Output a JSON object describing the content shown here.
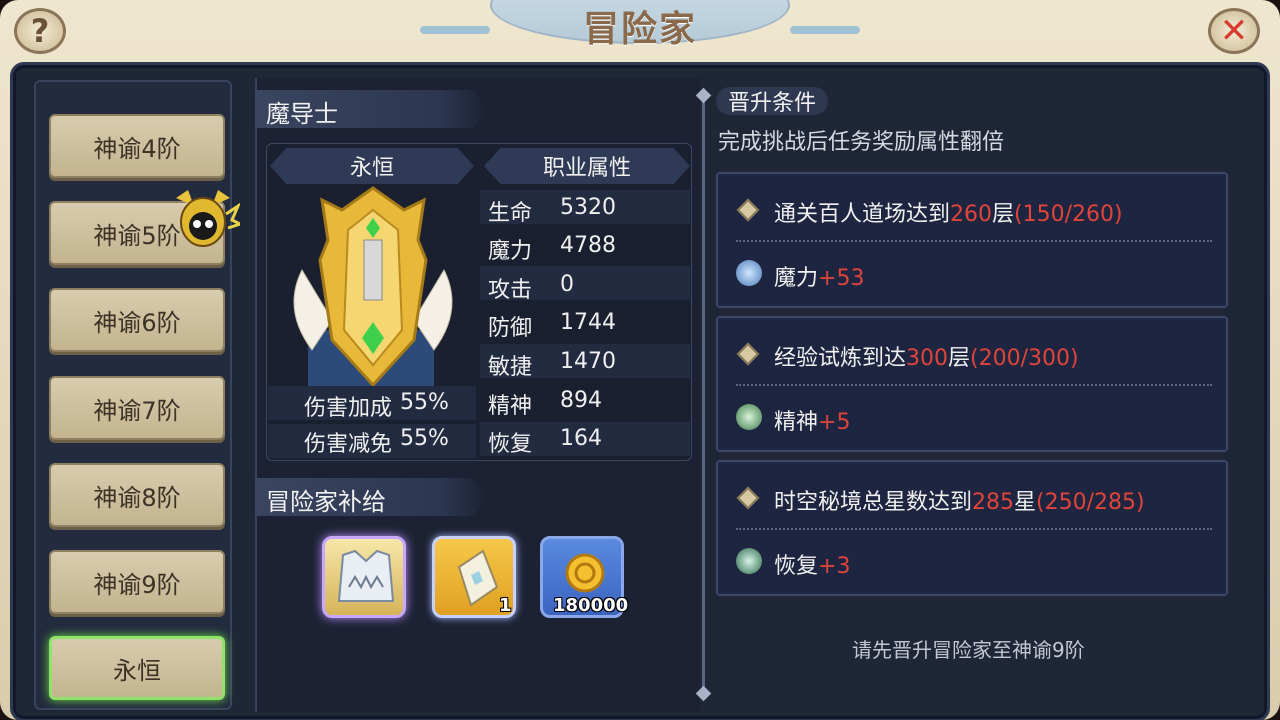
{
  "title": "冒险家",
  "header": {
    "help_icon": "question-icon",
    "close_icon": "close-x-icon"
  },
  "tabs": [
    {
      "label": "神谕4阶",
      "active": false
    },
    {
      "label": "神谕5阶",
      "active": false
    },
    {
      "label": "神谕6阶",
      "active": false
    },
    {
      "label": "神谕7阶",
      "active": false
    },
    {
      "label": "神谕8阶",
      "active": false
    },
    {
      "label": "神谕9阶",
      "active": false
    },
    {
      "label": "永恒",
      "active": true
    }
  ],
  "class_panel": {
    "class_name": "魔导士",
    "rank_header": "永恒",
    "attr_header": "职业属性",
    "bonuses": [
      {
        "label": "伤害加成",
        "value": "55%"
      },
      {
        "label": "伤害减免",
        "value": "55%"
      }
    ],
    "stats": [
      {
        "label": "生命",
        "value": "5320"
      },
      {
        "label": "魔力",
        "value": "4788"
      },
      {
        "label": "攻击",
        "value": "0"
      },
      {
        "label": "防御",
        "value": "1744"
      },
      {
        "label": "敏捷",
        "value": "1470"
      },
      {
        "label": "精神",
        "value": "894"
      },
      {
        "label": "恢复",
        "value": "164"
      }
    ],
    "supply_header": "冒险家补给",
    "supplies": [
      {
        "icon": "armor-icon",
        "count": ""
      },
      {
        "icon": "scroll-icon",
        "count": "1"
      },
      {
        "icon": "gold-coin-icon",
        "count": "180000"
      }
    ]
  },
  "promotion": {
    "header": "晋升条件",
    "subtitle": "完成挑战后任务奖励属性翻倍",
    "conditions": [
      {
        "text_a": "通关百人道场达到",
        "num": "260",
        "text_b": "层",
        "progress": "(150/260)",
        "reward_label": "魔力",
        "reward_value": "+53",
        "reward_icon": "magic-icon"
      },
      {
        "text_a": "经验试炼到达",
        "num": "300",
        "text_b": "层",
        "progress": "(200/300)",
        "reward_label": "精神",
        "reward_value": "+5",
        "reward_icon": "spirit-icon"
      },
      {
        "text_a": "时空秘境总星数达到",
        "num": "285",
        "text_b": "星",
        "progress": "(250/285)",
        "reward_label": "恢复",
        "reward_value": "+3",
        "reward_icon": "recovery-icon"
      }
    ],
    "hint": "请先晋升冒险家至神谕9阶"
  }
}
